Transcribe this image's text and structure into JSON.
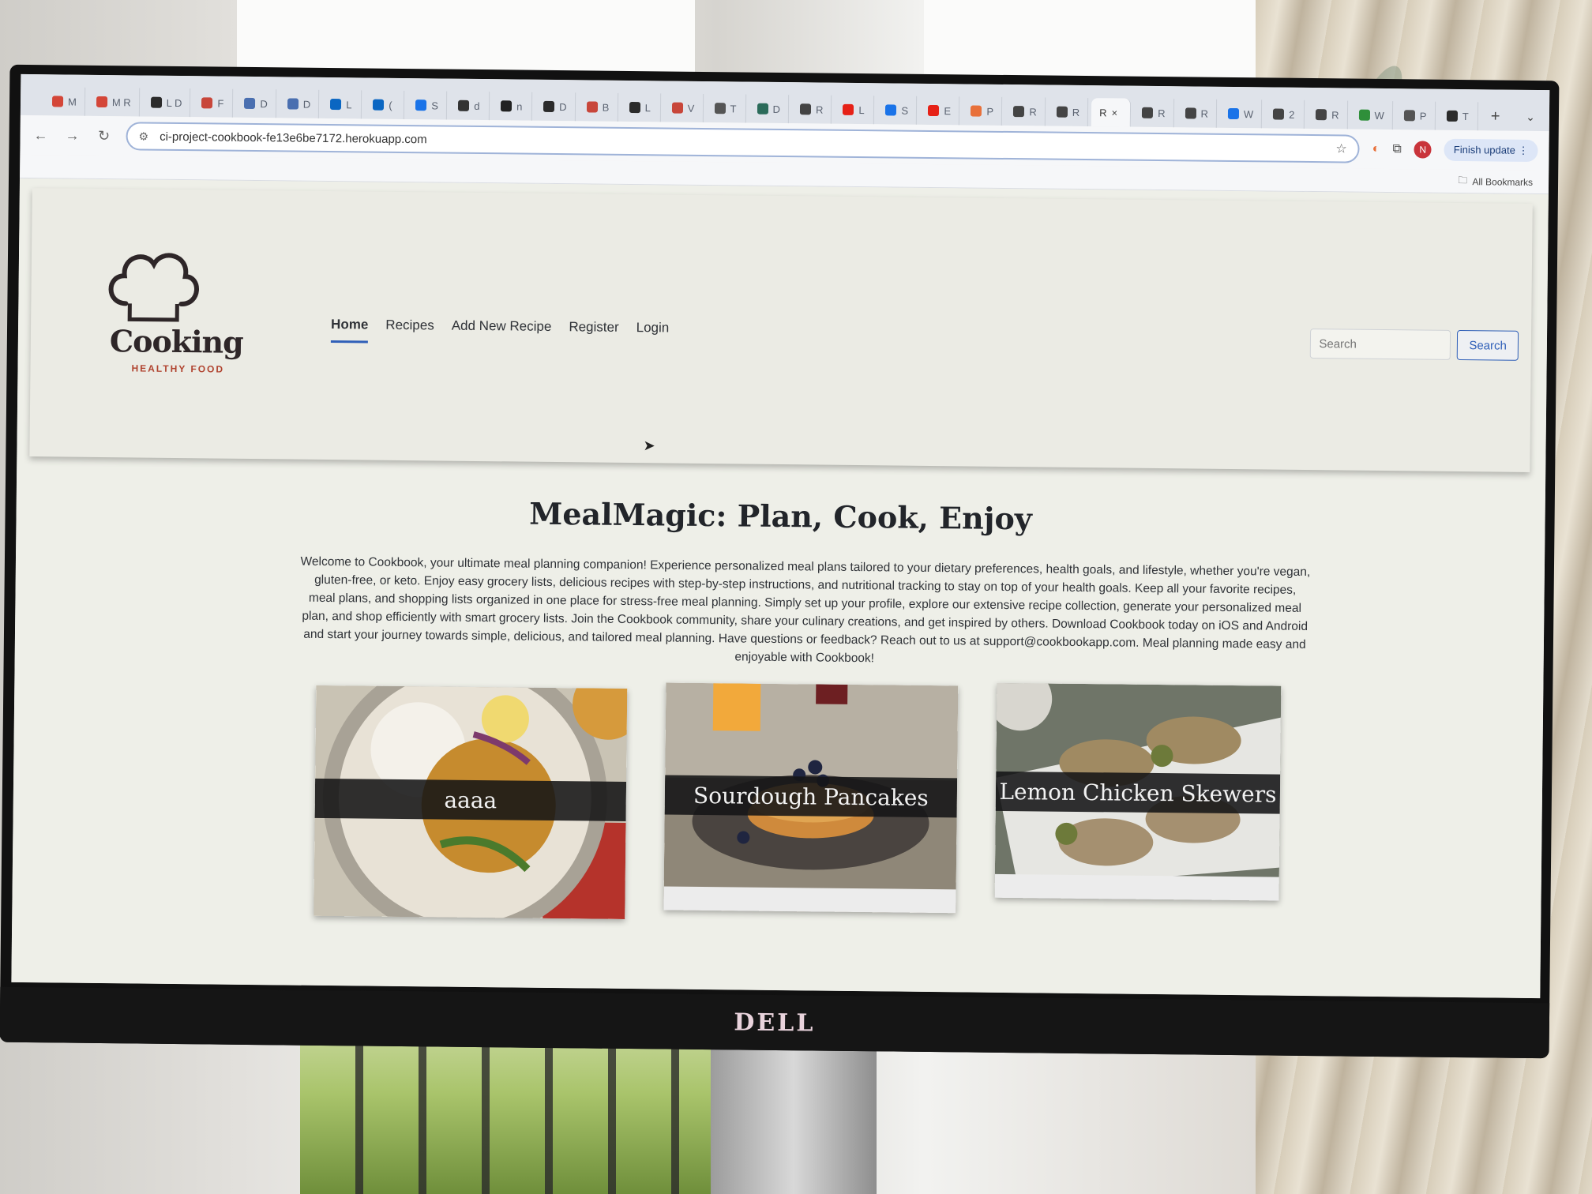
{
  "browser": {
    "tabs": [
      {
        "label": "M",
        "color": "#d44638"
      },
      {
        "label": "M R",
        "color": "#d44638"
      },
      {
        "label": "L D",
        "color": "#2b2b2b"
      },
      {
        "label": "F",
        "color": "#c8463a"
      },
      {
        "label": "D",
        "color": "#4a6fb0"
      },
      {
        "label": "D",
        "color": "#4a6fb0"
      },
      {
        "label": "L",
        "color": "#0a66c2"
      },
      {
        "label": "(",
        "color": "#0a66c2"
      },
      {
        "label": "S",
        "color": "#1a73e8"
      },
      {
        "label": "d",
        "color": "#333333"
      },
      {
        "label": "n",
        "color": "#222222"
      },
      {
        "label": "D",
        "color": "#2b2b2b"
      },
      {
        "label": "B",
        "color": "#c8463a"
      },
      {
        "label": "L",
        "color": "#2b2b2b"
      },
      {
        "label": "V",
        "color": "#c8463a"
      },
      {
        "label": "T",
        "color": "#555555"
      },
      {
        "label": "D",
        "color": "#2b6b5a"
      },
      {
        "label": "R",
        "color": "#444444"
      },
      {
        "label": "L",
        "color": "#e62117"
      },
      {
        "label": "S",
        "color": "#1a73e8"
      },
      {
        "label": "E",
        "color": "#e62117"
      },
      {
        "label": "P",
        "color": "#e8703a"
      },
      {
        "label": "R",
        "color": "#444444"
      },
      {
        "label": "R",
        "color": "#444444"
      }
    ],
    "active_tab": {
      "label": "R",
      "close": "×"
    },
    "tabs_after": [
      {
        "label": "R",
        "color": "#444444"
      },
      {
        "label": "R",
        "color": "#444444"
      },
      {
        "label": "W",
        "color": "#1a73e8"
      },
      {
        "label": "2",
        "color": "#444444"
      },
      {
        "label": "R",
        "color": "#444444"
      },
      {
        "label": "W",
        "color": "#2f8f3a"
      },
      {
        "label": "P",
        "color": "#555555"
      },
      {
        "label": "T",
        "color": "#2b2b2b"
      }
    ],
    "new_tab": "+",
    "tab_menu": "⌄",
    "back": "←",
    "forward": "→",
    "reload": "↻",
    "url": "ci-project-cookbook-fe13e6be7172.herokuapp.com",
    "profile_initial": "N",
    "finish_update": "Finish update",
    "all_bookmarks": "All Bookmarks"
  },
  "site": {
    "logo": {
      "word": "Cooking",
      "tagline": "HEALTHY FOOD"
    },
    "nav": [
      {
        "label": "Home",
        "active": true
      },
      {
        "label": "Recipes",
        "active": false
      },
      {
        "label": "Add New Recipe",
        "active": false
      },
      {
        "label": "Register",
        "active": false
      },
      {
        "label": "Login",
        "active": false
      }
    ],
    "search": {
      "placeholder": "Search",
      "button": "Search"
    },
    "hero": {
      "title": "MealMagic: Plan, Cook, Enjoy",
      "text": "Welcome to Cookbook, your ultimate meal planning companion! Experience personalized meal plans tailored to your dietary preferences, health goals, and lifestyle, whether you're vegan, gluten-free, or keto. Enjoy easy grocery lists, delicious recipes with step-by-step instructions, and nutritional tracking to stay on top of your health goals. Keep all your favorite recipes, meal plans, and shopping lists organized in one place for stress-free meal planning. Simply set up your profile, explore our extensive recipe collection, generate your personalized meal plan, and shop efficiently with smart grocery lists. Join the Cookbook community, share your culinary creations, and get inspired by others. Download Cookbook today on iOS and Android and start your journey towards simple, delicious, and tailored meal planning. Have questions or feedback? Reach out to us at support@cookbookapp.com. Meal planning made easy and enjoyable with Cookbook!"
    },
    "cards": [
      {
        "title": "aaaa",
        "image": "chickpea-rice-bowl"
      },
      {
        "title": "Sourdough Pancakes",
        "image": "pancakes-with-blueberries"
      },
      {
        "title": "Lemon Chicken Skewers",
        "image": "grilled-chicken-skewers"
      }
    ]
  },
  "monitor": {
    "brand": "DELL"
  }
}
